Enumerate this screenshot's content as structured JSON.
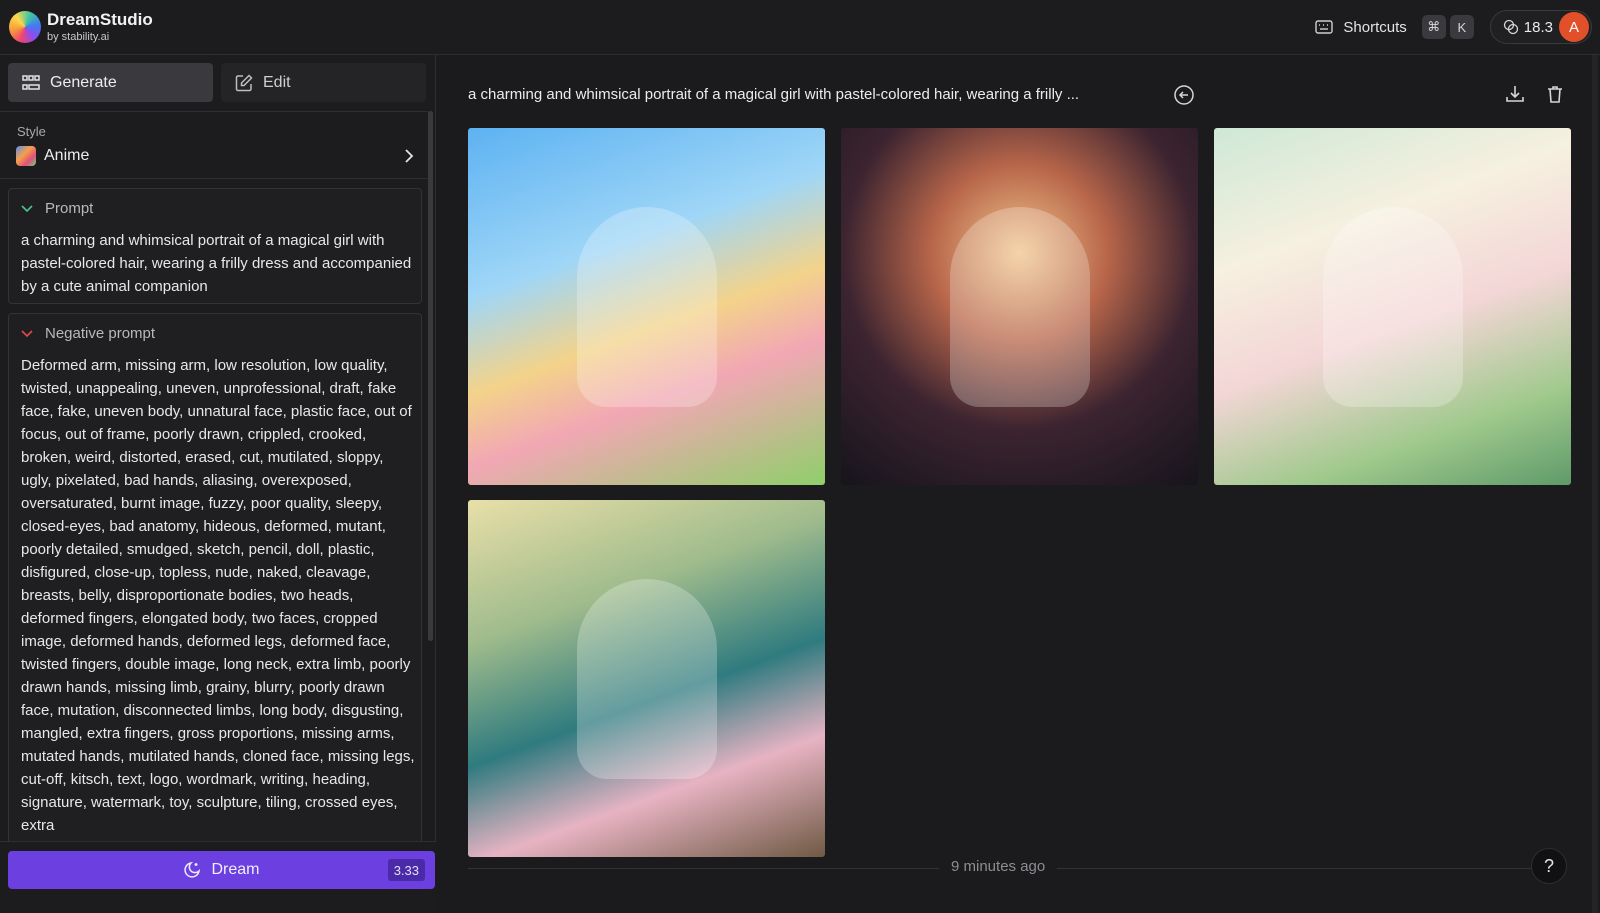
{
  "brand": {
    "name": "DreamStudio",
    "sub": "by stability.ai"
  },
  "topbar": {
    "shortcuts_label": "Shortcuts",
    "shortcut_keys": [
      "⌘",
      "K"
    ],
    "credits": "18.3",
    "avatar_initial": "A"
  },
  "sidebar": {
    "modes": [
      {
        "label": "Generate",
        "icon": "grid-icon",
        "active": true
      },
      {
        "label": "Edit",
        "icon": "edit-icon",
        "active": false
      }
    ],
    "style": {
      "label": "Style",
      "value": "Anime"
    },
    "prompt": {
      "title": "Prompt",
      "text": "a charming and whimsical portrait of a magical girl with pastel-colored hair, wearing a frilly dress and accompanied by a cute animal companion"
    },
    "negative_prompt": {
      "title": "Negative prompt",
      "text": "Deformed arm, missing arm, low resolution, low quality, twisted, unappealing, uneven, unprofessional, draft, fake face, fake, uneven body, unnatural face, plastic face, out of focus, out of frame, poorly drawn, crippled, crooked, broken, weird, distorted, erased, cut, mutilated, sloppy, ugly, pixelated, bad hands, aliasing, overexposed, oversaturated, burnt image, fuzzy, poor quality, sleepy, closed-eyes, bad anatomy, hideous, deformed, mutant, poorly detailed, smudged, sketch, pencil, doll, plastic, disfigured, close-up, topless, nude, naked, cleavage, breasts, belly, disproportionate bodies, two heads, deformed fingers, elongated body, two faces, cropped image, deformed hands, deformed legs, deformed face, twisted fingers, double image, long neck, extra limb, poorly drawn hands, missing limb, grainy, blurry, poorly drawn face, mutation, disconnected limbs, long body, disgusting, mangled, extra fingers, gross proportions, missing arms, mutated hands, mutilated hands, cloned face, missing legs, cut-off, kitsch, text, logo, wordmark, writing, heading, signature, watermark, toy, sculpture, tiling, crossed eyes, extra"
    },
    "dream": {
      "label": "Dream",
      "cost": "3.33"
    }
  },
  "main": {
    "generation_prompt": "a charming and whimsical portrait of a magical girl with pastel-colored hair, wearing a frilly ...",
    "time_label": "9 minutes ago",
    "help_label": "?"
  },
  "colors": {
    "accent": "#6b3fe0",
    "background": "#1b1b1d",
    "avatar": "#e2502a"
  }
}
